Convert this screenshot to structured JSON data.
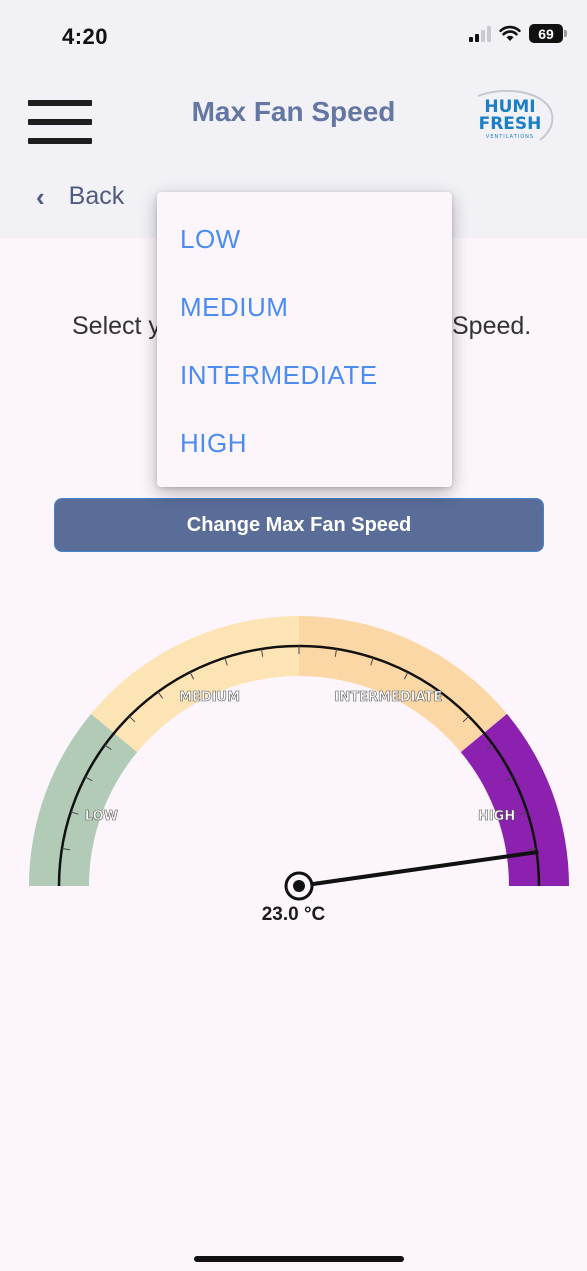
{
  "status_bar": {
    "time": "4:20",
    "battery": "69",
    "icons": [
      "signal-icon",
      "wifi-icon",
      "battery-icon"
    ]
  },
  "header": {
    "title": "Max Fan Speed",
    "logo": {
      "line1": "HUMI",
      "line2": "FRESH",
      "line3": "VENTILATIONS"
    },
    "back_label": "Back"
  },
  "main": {
    "instruction_start": "Select y",
    "instruction_end": "Speed.",
    "change_button": "Change Max Fan Speed"
  },
  "dropdown": {
    "options": [
      "LOW",
      "MEDIUM",
      "INTERMEDIATE",
      "HIGH"
    ]
  },
  "gauge": {
    "bands": [
      {
        "label": "LOW",
        "start": 0,
        "end": 0.22,
        "color": "#b1cbb6"
      },
      {
        "label": "MEDIUM",
        "start": 0.22,
        "end": 0.5,
        "color": "#fde4b5"
      },
      {
        "label": "INTERMEDIATE",
        "start": 0.5,
        "end": 0.78,
        "color": "#fcd7a6"
      },
      {
        "label": "HIGH",
        "start": 0.78,
        "end": 1,
        "color": "#8b21ae"
      }
    ],
    "needle_fraction": 0.955,
    "readout": "23.0 °C"
  },
  "colors": {
    "accent": "#4b8cf0",
    "button": "#5a6d99",
    "title": "#6476a2"
  }
}
